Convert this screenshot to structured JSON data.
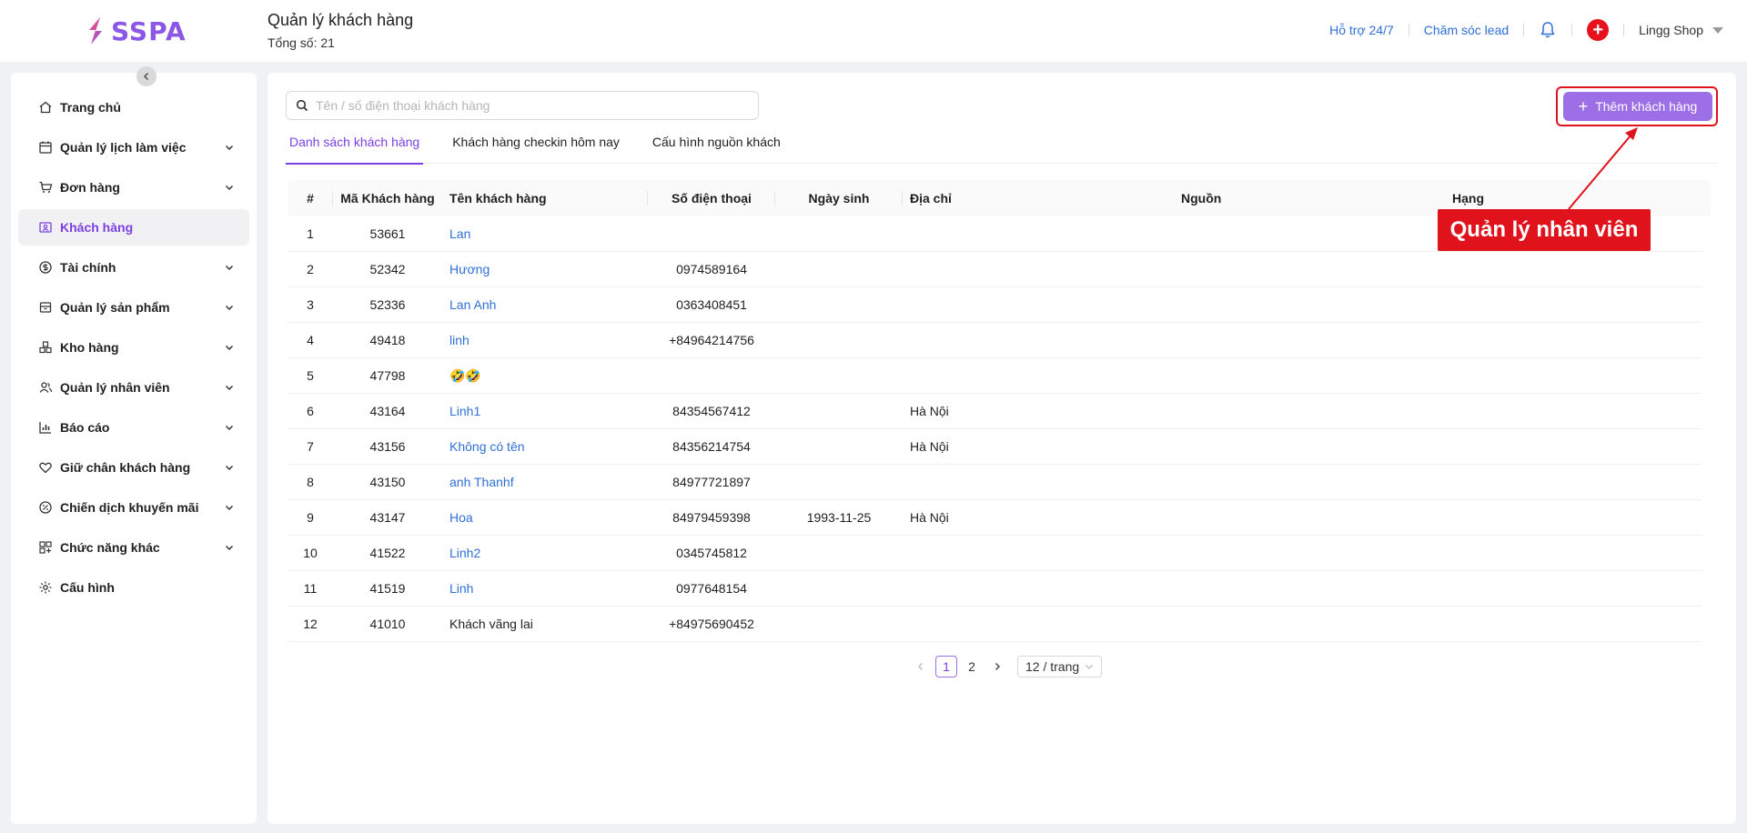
{
  "header": {
    "brand": "SSPA",
    "title": "Quản lý khách hàng",
    "subtitle": "Tổng số: 21",
    "support_link": "Hỗ trợ 24/7",
    "lead_link": "Chăm sóc lead",
    "shop_name": "Lingg Shop"
  },
  "sidebar": {
    "items": [
      {
        "label": "Trang chủ"
      },
      {
        "label": "Quản lý lịch làm việc"
      },
      {
        "label": "Đơn hàng"
      },
      {
        "label": "Khách hàng"
      },
      {
        "label": "Tài chính"
      },
      {
        "label": "Quản lý sản phẩm"
      },
      {
        "label": "Kho hàng"
      },
      {
        "label": "Quản lý nhân viên"
      },
      {
        "label": "Báo cáo"
      },
      {
        "label": "Giữ chân khách hàng"
      },
      {
        "label": "Chiến dịch khuyến mãi"
      },
      {
        "label": "Chức năng khác"
      },
      {
        "label": "Cấu hình"
      }
    ]
  },
  "main": {
    "search_placeholder": "Tên / số điện thoại khách hàng",
    "add_button": "Thêm khách hàng",
    "tabs": [
      {
        "label": "Danh sách khách hàng"
      },
      {
        "label": "Khách hàng checkin hôm nay"
      },
      {
        "label": "Cấu hình nguồn khách"
      }
    ],
    "table": {
      "columns": [
        "#",
        "Mã Khách hàng",
        "Tên khách hàng",
        "Số điện thoại",
        "Ngày sinh",
        "Địa chỉ",
        "Nguồn",
        "Hạng"
      ],
      "rows": [
        {
          "no": "1",
          "id": "53661",
          "name": "Lan",
          "phone": "",
          "dob": "",
          "addr": ""
        },
        {
          "no": "2",
          "id": "52342",
          "name": "Hương",
          "phone": "0974589164",
          "dob": "",
          "addr": ""
        },
        {
          "no": "3",
          "id": "52336",
          "name": "Lan Anh",
          "phone": "0363408451",
          "dob": "",
          "addr": ""
        },
        {
          "no": "4",
          "id": "49418",
          "name": "linh",
          "phone": "+84964214756",
          "dob": "",
          "addr": ""
        },
        {
          "no": "5",
          "id": "47798",
          "name": "🤣🤣",
          "phone": "",
          "dob": "",
          "addr": ""
        },
        {
          "no": "6",
          "id": "43164",
          "name": "Linh1",
          "phone": "84354567412",
          "dob": "",
          "addr": "Hà Nội"
        },
        {
          "no": "7",
          "id": "43156",
          "name": "Không có tên",
          "phone": "84356214754",
          "dob": "",
          "addr": "Hà Nội"
        },
        {
          "no": "8",
          "id": "43150",
          "name": "anh Thanhf",
          "phone": "84977721897",
          "dob": "",
          "addr": ""
        },
        {
          "no": "9",
          "id": "43147",
          "name": "Hoa",
          "phone": "84979459398",
          "dob": "1993-11-25",
          "addr": "Hà Nội"
        },
        {
          "no": "10",
          "id": "41522",
          "name": "Linh2",
          "phone": "0345745812",
          "dob": "",
          "addr": ""
        },
        {
          "no": "11",
          "id": "41519",
          "name": "Linh",
          "phone": "0977648154",
          "dob": "",
          "addr": ""
        },
        {
          "no": "12",
          "id": "41010",
          "name": "Khách vãng lai",
          "phone": "+84975690452",
          "dob": "",
          "addr": ""
        }
      ]
    },
    "pagination": {
      "pages": [
        "1",
        "2"
      ],
      "page_size": "12 / trang"
    }
  },
  "annotation": {
    "label": "Quản lý nhân viên"
  },
  "colors": {
    "brand": "#8b57e6",
    "active": "#7b3fe4",
    "link": "#2f6fd6",
    "annotation": "#e0121c"
  }
}
